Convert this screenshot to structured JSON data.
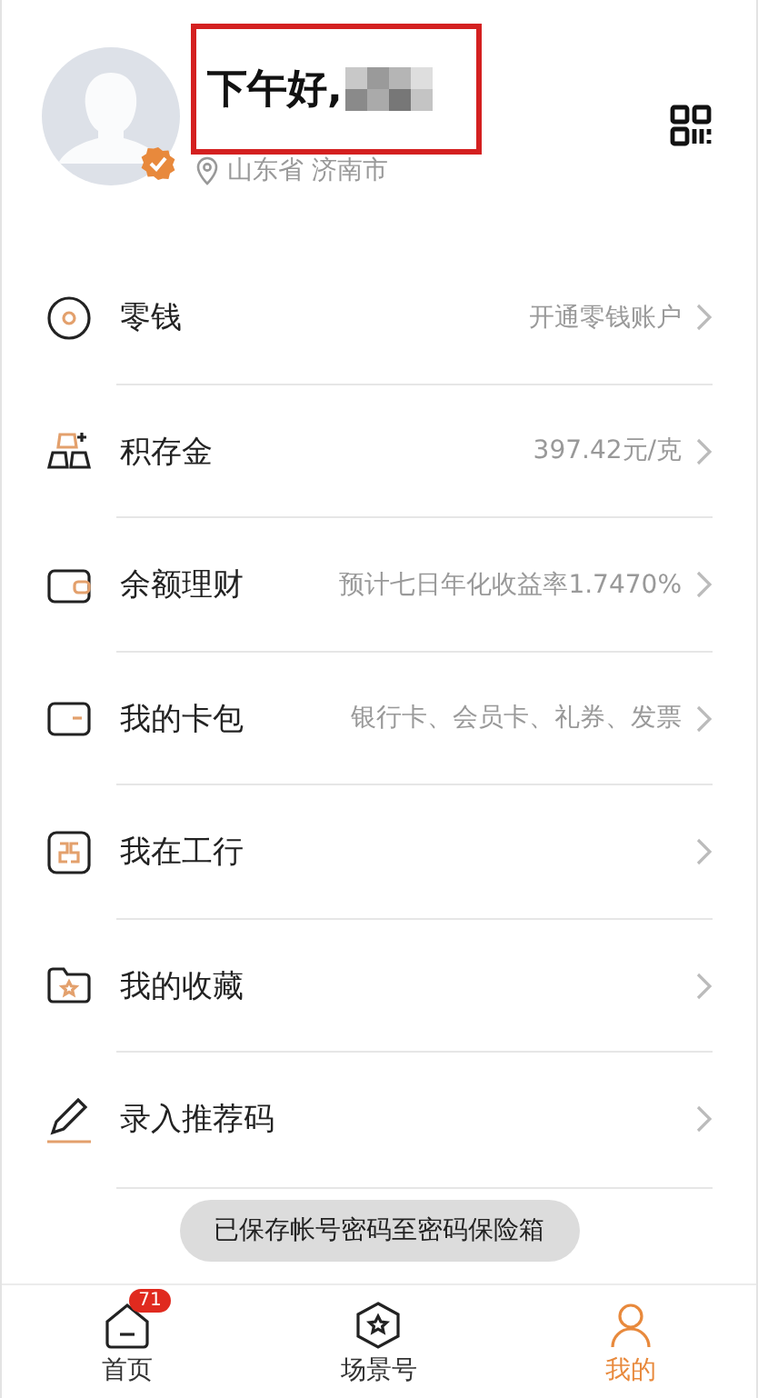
{
  "profile": {
    "greeting": "下午好,",
    "verified": true,
    "location": "山东省 济南市",
    "highlighted": true
  },
  "menu": [
    {
      "kind": "coin",
      "label": "零钱",
      "detail": "开通零钱账户"
    },
    {
      "kind": "gold",
      "label": "积存金",
      "detail": "397.42元/克"
    },
    {
      "kind": "wallet",
      "label": "余额理财",
      "detail": "预计七日年化收益率1.7470%"
    },
    {
      "kind": "card",
      "label": "我的卡包",
      "detail": "银行卡、会员卡、礼券、发票"
    },
    {
      "kind": "bank",
      "label": "我在工行"
    },
    {
      "kind": "folder",
      "label": "我的收藏"
    },
    {
      "kind": "pen",
      "label": "录入推荐码"
    }
  ],
  "toast": "已保存帐号密码至密码保险箱",
  "tabs": [
    {
      "kind": "home",
      "label": "首页",
      "badge": "71",
      "selected": false
    },
    {
      "kind": "scene",
      "label": "场景号",
      "selected": false
    },
    {
      "kind": "me",
      "label": "我的",
      "selected": true
    }
  ]
}
